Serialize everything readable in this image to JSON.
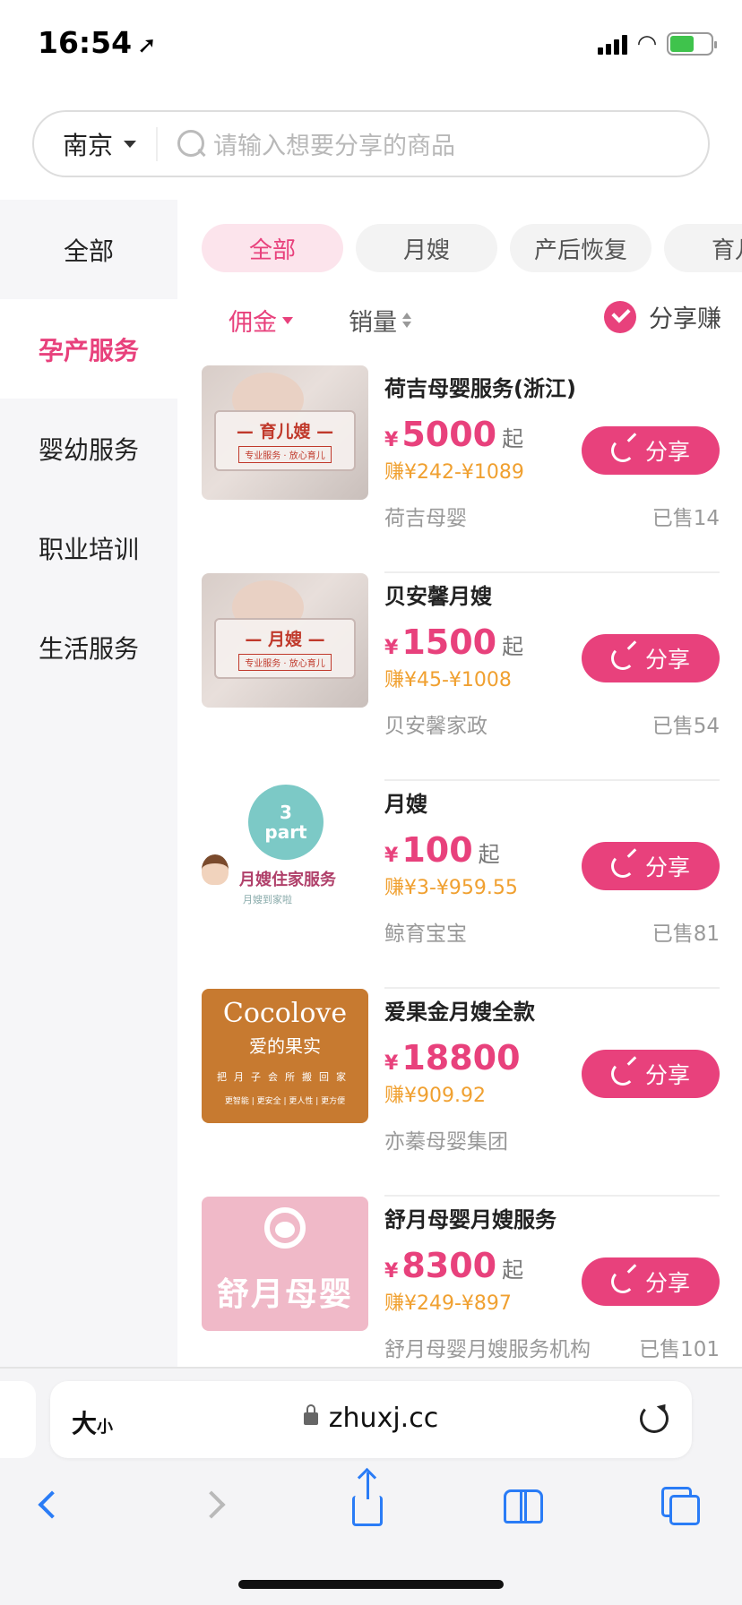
{
  "status_bar": {
    "time": "16:54"
  },
  "search": {
    "city": "南京",
    "placeholder": "请输入想要分享的商品"
  },
  "sidebar": {
    "items": [
      {
        "label": "全部"
      },
      {
        "label": "孕产服务"
      },
      {
        "label": "婴幼服务"
      },
      {
        "label": "职业培训"
      },
      {
        "label": "生活服务"
      }
    ],
    "active_index": 1
  },
  "category_tabs": [
    {
      "label": "全部"
    },
    {
      "label": "月嫂"
    },
    {
      "label": "产后恢复"
    },
    {
      "label": "育儿"
    }
  ],
  "sort": {
    "commission_label": "佣金",
    "sales_label": "销量",
    "share_earn_label": "分享赚"
  },
  "products": [
    {
      "name": "荷吉母婴服务(浙江)",
      "currency": "¥",
      "price": "5000",
      "price_suffix": "起",
      "earn": "赚¥242-¥1089",
      "seller": "荷吉母婴",
      "sold": "已售14",
      "share_label": "分享",
      "thumb": {
        "title": "— 育儿嫂 —",
        "tag": "专业服务 · 放心育儿"
      }
    },
    {
      "name": "贝安馨月嫂",
      "currency": "¥",
      "price": "1500",
      "price_suffix": "起",
      "earn": "赚¥45-¥1008",
      "seller": "贝安馨家政",
      "sold": "已售54",
      "share_label": "分享",
      "thumb": {
        "title": "— 月嫂 —",
        "tag": "专业服务 · 放心育儿"
      }
    },
    {
      "name": "月嫂",
      "currency": "¥",
      "price": "100",
      "price_suffix": "起",
      "earn": "赚¥3-¥959.55",
      "seller": "鲸育宝宝",
      "sold": "已售81",
      "share_label": "分享",
      "thumb": {
        "bubble_num": "3",
        "bubble_word": "part",
        "title": "月嫂住家服务",
        "sub": "月嫂到家啦"
      }
    },
    {
      "name": "爱果金月嫂全款",
      "currency": "¥",
      "price": "18800",
      "price_suffix": "",
      "earn": "赚¥909.92",
      "seller": "亦蓁母婴集团",
      "sold": "",
      "share_label": "分享",
      "thumb": {
        "brand": "Cocolove",
        "cn": "爱的果实",
        "line": "把月子会所搬回家",
        "tags": "更智能 | 更安全 | 更人性 | 更方便"
      }
    },
    {
      "name": "舒月母婴月嫂服务",
      "currency": "¥",
      "price": "8300",
      "price_suffix": "起",
      "earn": "赚¥249-¥897",
      "seller": "舒月母婴月嫂服务机构",
      "sold": "已售101",
      "share_label": "分享",
      "thumb": {
        "title": "舒月母婴"
      }
    }
  ],
  "browser": {
    "text_size_label": "大",
    "text_size_small": "小",
    "url": "zhuxj.cc"
  },
  "colors": {
    "accent": "#e8417c",
    "earn": "#f0a030",
    "ios_blue": "#2a7cf6"
  }
}
